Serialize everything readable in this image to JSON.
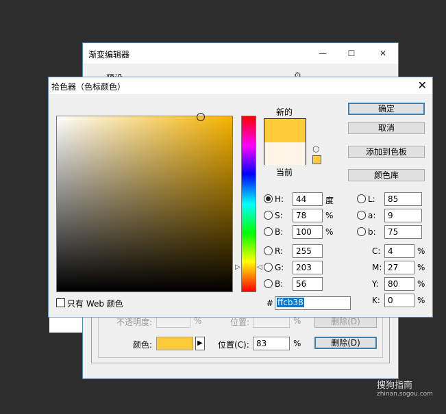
{
  "gradient_editor": {
    "title": "渐变编辑器",
    "presets_label": "预设",
    "opacity_label": "不透明度:",
    "opacity_unit": "%",
    "position_label_faded": "位置:",
    "position_unit_faded": "%",
    "delete_faded": "删除(D)",
    "color_label": "颜色:",
    "position_label": "位置(C):",
    "position_value": "83",
    "position_unit": "%",
    "delete_label": "删除(D)"
  },
  "picker": {
    "title": "拾色器（色标颜色）",
    "new_label": "新的",
    "current_label": "当前",
    "new_color": "#ffcb38",
    "current_color": "#fff6e8",
    "hue_color": "#f7b300",
    "buttons": {
      "ok": "确定",
      "cancel": "取消",
      "add_swatch": "添加到色板",
      "libraries": "颜色库"
    },
    "hsb": [
      {
        "label": "H:",
        "value": "44",
        "unit": "度",
        "checked": true
      },
      {
        "label": "S:",
        "value": "78",
        "unit": "%",
        "checked": false
      },
      {
        "label": "B:",
        "value": "100",
        "unit": "%",
        "checked": false
      }
    ],
    "rgb": [
      {
        "label": "R:",
        "value": "255"
      },
      {
        "label": "G:",
        "value": "203"
      },
      {
        "label": "B:",
        "value": "56"
      }
    ],
    "lab": [
      {
        "label": "L:",
        "value": "85"
      },
      {
        "label": "a:",
        "value": "9"
      },
      {
        "label": "b:",
        "value": "75"
      }
    ],
    "cmyk": [
      {
        "label": "C:",
        "value": "4",
        "unit": "%"
      },
      {
        "label": "M:",
        "value": "27",
        "unit": "%"
      },
      {
        "label": "Y:",
        "value": "80",
        "unit": "%"
      },
      {
        "label": "K:",
        "value": "0",
        "unit": "%"
      }
    ],
    "hex_prefix": "#",
    "hex_value": "ffcb38",
    "web_only_label": "只有 Web 颜色"
  },
  "watermark": {
    "text": "搜狗指南",
    "url": "zhinan.sogou.com"
  }
}
